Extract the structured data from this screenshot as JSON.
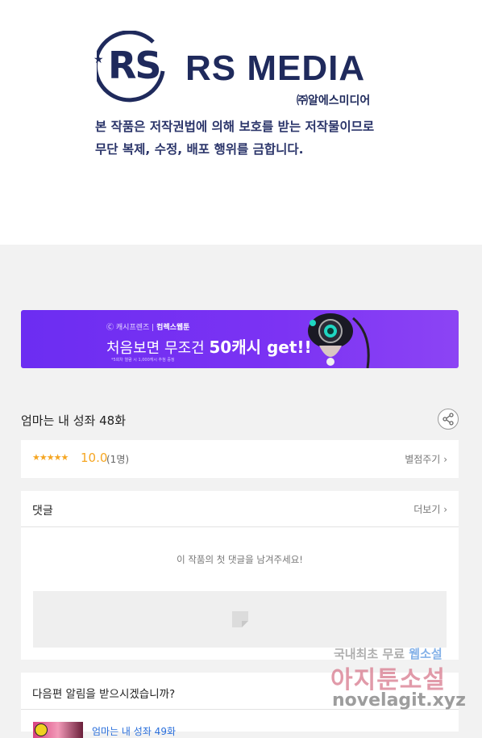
{
  "logo": {
    "initials": "RS",
    "name": "RS MEDIA",
    "subname": "㈜알에스미디어"
  },
  "copyright": {
    "line1": "본 작품은 저작권법에 의해 보호를 받는 저작물이므로",
    "line2": "무단 복제, 수정, 배포 행위를 금합니다."
  },
  "banner": {
    "brand1": "캐시프렌즈",
    "brand2": "컴렉스웹툰",
    "headline_pre": "처음보면 무조건",
    "headline_big": "50캐시 get!!",
    "note": "*5회차 열람 시 1,000캐시 추첨 증정"
  },
  "episode": {
    "title": "엄마는 내 성좌 48화"
  },
  "rating": {
    "stars": "★★★★★",
    "score": "10.0",
    "count": "(1명)",
    "rate_label": "별점주기"
  },
  "comments": {
    "title": "댓글",
    "more": "더보기",
    "empty": "이 작품의 첫 댓글을 남겨주세요!"
  },
  "notify": {
    "question": "다음편 알림을 받으시겠습니까?",
    "next_title": "엄마는 내 성좌 49화"
  },
  "watermark": {
    "line1_a": "국내최초 무료",
    "line1_b": "웹소설",
    "line2": "아지툰소설",
    "line3": "novelagit.xyz"
  },
  "colors": {
    "brand_navy": "#1f2a5c",
    "banner_purple": "#7c33f3",
    "rating_orange": "#f5a623"
  }
}
